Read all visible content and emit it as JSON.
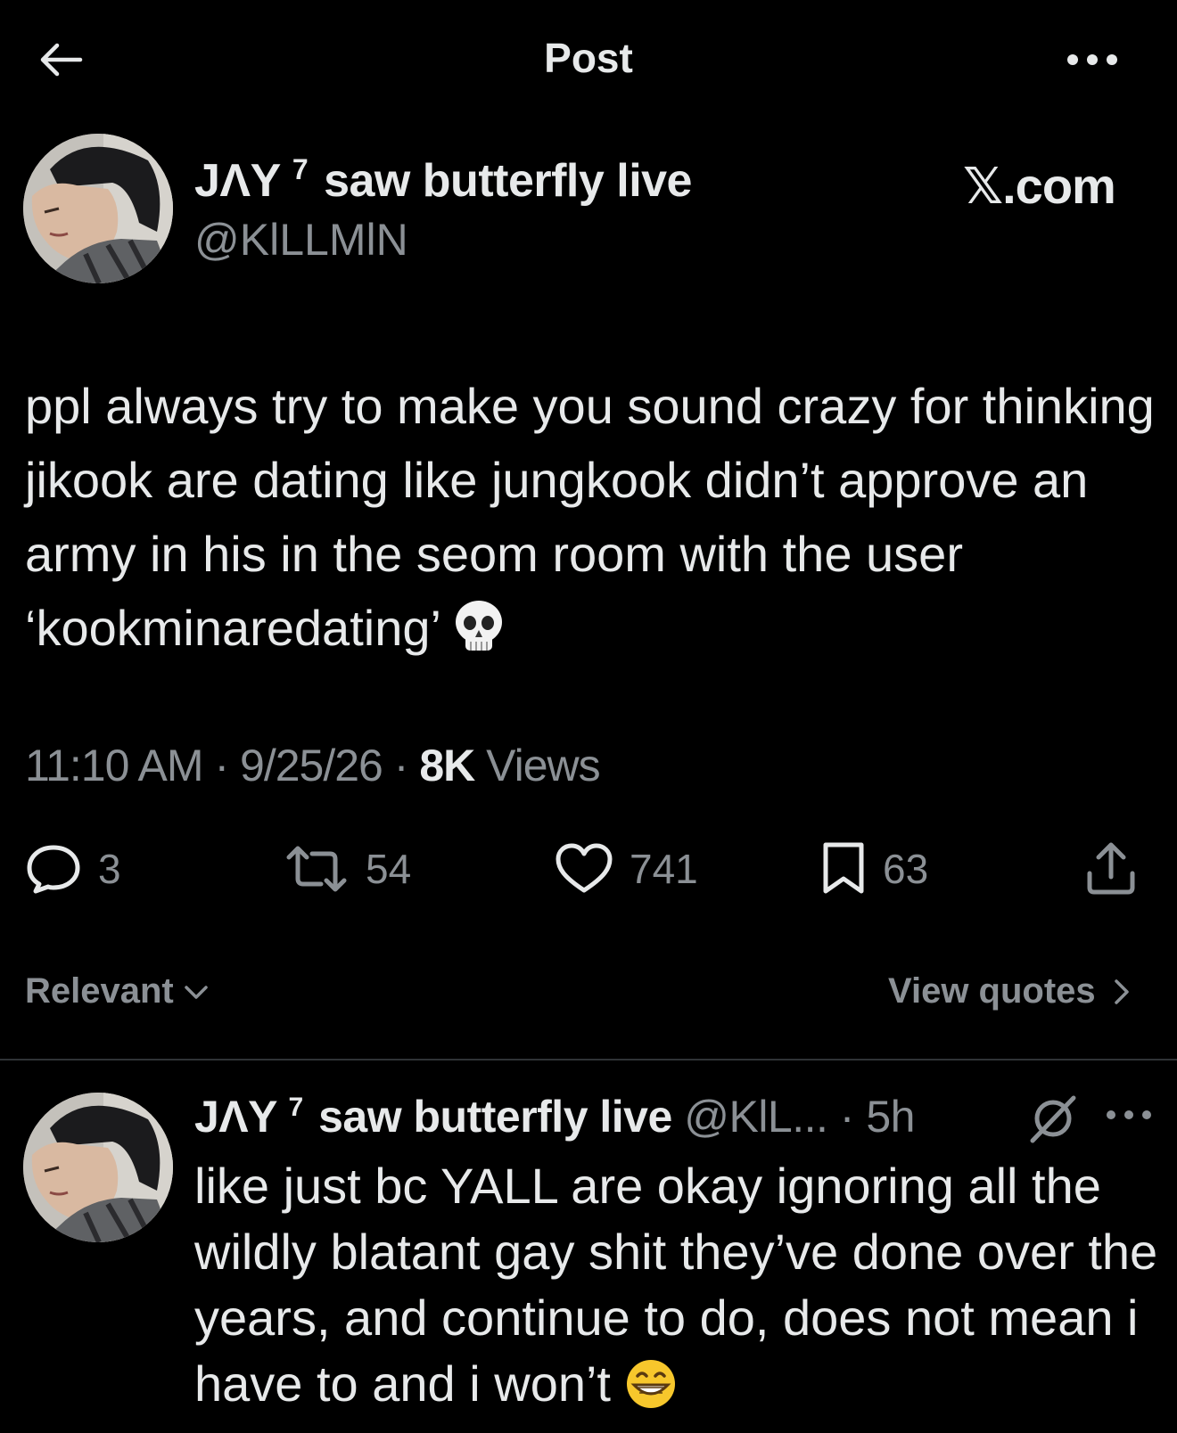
{
  "header": {
    "title": "Post",
    "back_icon": "arrow-left-icon",
    "more_icon": "ellipsis-icon"
  },
  "tweet": {
    "author_name": "JΛY",
    "author_superscript": "7",
    "author_name_rest": "saw butterfly live",
    "handle": "@KlLLMlN",
    "source_label": "𝕏.com",
    "text": "ppl always try to make you sound crazy for thinking jikook are dating like jungkook didn’t approve an army in his in the seom room with the user ‘kookminaredating’",
    "text_emoji": "skull-emoji",
    "time": "11:10 AM",
    "date": "9/25/26",
    "views_count": "8K",
    "views_label": "Views",
    "separator": "·",
    "actions": {
      "replies": "3",
      "reposts": "54",
      "likes": "741",
      "bookmarks": "63"
    }
  },
  "sort": {
    "label": "Relevant",
    "view_quotes_label": "View quotes"
  },
  "reply": {
    "author_name": "JΛY",
    "author_superscript": "7",
    "author_name_rest": "saw butterfly live",
    "handle_time": "@KlL... · 5h",
    "text": "like just bc YALL are okay ignoring all the wildly blatant gay shit they’ve done over the years, and continue to do, does not mean i have to and i won’t",
    "text_emoji": "grinning-emoji"
  },
  "colors": {
    "background": "#000000",
    "text_primary": "#e7e9ea",
    "text_secondary": "#8b9095",
    "divider": "#2f3336"
  }
}
